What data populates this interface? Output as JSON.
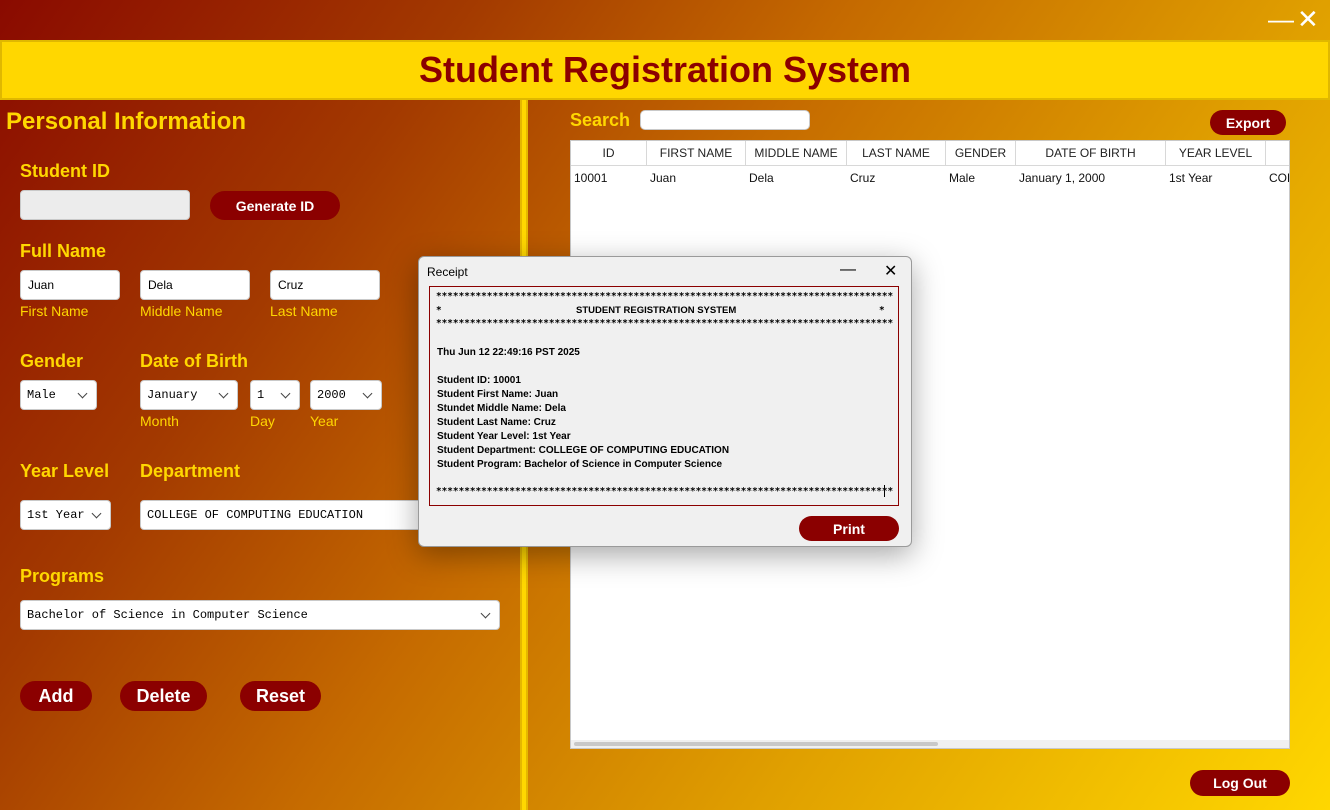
{
  "window": {
    "minimize": "—",
    "close": "✕"
  },
  "header": {
    "title": "Student Registration System"
  },
  "personal": {
    "title": "Personal Information",
    "student_id": {
      "label": "Student ID",
      "value": "",
      "button": "Generate ID"
    },
    "full_name": {
      "label": "Full Name",
      "first": {
        "value": "Juan",
        "caption": "First Name"
      },
      "middle": {
        "value": "Dela",
        "caption": "Middle Name"
      },
      "last": {
        "value": "Cruz",
        "caption": "Last Name"
      }
    },
    "gender": {
      "label": "Gender",
      "value": "Male"
    },
    "dob": {
      "label": "Date of Birth",
      "month": {
        "value": "January",
        "caption": "Month"
      },
      "day": {
        "value": "1",
        "caption": "Day"
      },
      "year": {
        "value": "2000",
        "caption": "Year"
      }
    },
    "year_level": {
      "label": "Year Level",
      "value": "1st Year"
    },
    "department": {
      "label": "Department",
      "value": "COLLEGE OF COMPUTING EDUCATION"
    },
    "programs": {
      "label": "Programs",
      "value": "Bachelor of Science in Computer Science"
    },
    "buttons": {
      "add": "Add",
      "delete": "Delete",
      "reset": "Reset"
    }
  },
  "search": {
    "label": "Search",
    "value": ""
  },
  "export_button": "Export",
  "logout_button": "Log Out",
  "table": {
    "columns": [
      "ID",
      "FIRST NAME",
      "MIDDLE NAME",
      "LAST NAME",
      "GENDER",
      "DATE OF BIRTH",
      "YEAR LEVEL",
      ""
    ],
    "rows": [
      [
        "10001",
        "Juan",
        "Dela",
        "Cruz",
        "Male",
        "January 1, 2000",
        "1st Year",
        "COL"
      ]
    ]
  },
  "receipt": {
    "title": "Receipt",
    "minimize": "—",
    "close": "✕",
    "stars": "*********************************************************************************",
    "header_left": "*",
    "header_text": "STUDENT REGISTRATION SYSTEM",
    "header_right": "*",
    "datetime": "Thu Jun 12 22:49:16 PST 2025",
    "lines": [
      "Student ID: 10001",
      "Student First Name: Juan",
      "Stundet Middle Name: Dela",
      "Student Last Name: Cruz",
      "Student Year Level: 1st Year",
      "Student Department: COLLEGE OF COMPUTING EDUCATION",
      "Student Program: Bachelor of Science in Computer Science"
    ],
    "print_button": "Print"
  }
}
